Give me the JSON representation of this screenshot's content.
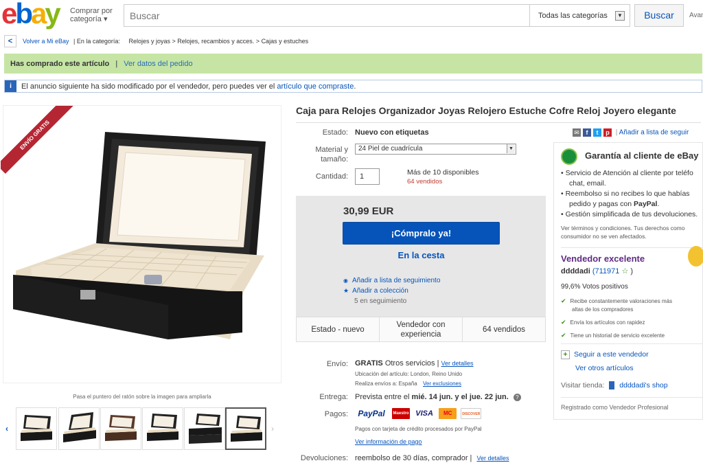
{
  "header": {
    "logo_letters": [
      "e",
      "b",
      "a",
      "y"
    ],
    "logo_colors": [
      "#e53238",
      "#0064d2",
      "#f5af02",
      "#86b817"
    ],
    "shop_by": "Comprar por",
    "shop_by_2": "categoría",
    "search_placeholder": "Buscar",
    "category_select": "Todas las categorías",
    "search_button": "Buscar",
    "advanced": "Avan"
  },
  "breadcrumb": {
    "back": "Volver a Mi eBay",
    "in_category": "| En la categoría:",
    "c1": "Relojes y joyas",
    "c2": "Relojes, recambios y acces.",
    "c3": "Cajas y estuches"
  },
  "purchased_banner": {
    "text": "Has comprado este artículo",
    "sep": "|",
    "link": "Ver datos del pedido"
  },
  "notice_banner": {
    "icon": "i",
    "text": "El anuncio siguiente ha sido modificado por el vendedor, pero puedes ver el",
    "link": "artículo que compraste",
    "end": "."
  },
  "image": {
    "ribbon": "ENVÍO GRATIS",
    "hint": "Pasa el puntero del ratón sobre la imagen para ampliarla",
    "prev_icon": "‹",
    "next_icon": "›"
  },
  "item": {
    "title": "Caja para Relojes Organizador Joyas Relojero Estuche Cofre Reloj Joyero elegante",
    "share_add": "Añadir a lista de seguir",
    "condition_label": "Estado:",
    "condition": "Nuevo con etiquetas",
    "variant_label": "Material y",
    "variant_label_2": "tamaño:",
    "variant_value": "24 Piel de cuadrícula",
    "qty_label": "Cantidad:",
    "qty_value": "1",
    "available": "Más de 10 disponibles",
    "sold": "64 vendidos",
    "price": "30,99 EUR",
    "buy_now": "¡Cómpralo ya!",
    "add_cart": "En la cesta",
    "watch": "Añadir a lista de seguimiento",
    "collection": "Añadir a colección",
    "watchers": "5 en seguimiento",
    "stat1": "Estado - nuevo",
    "stat2a": "Vendedor con",
    "stat2b": "experiencia",
    "stat3": "64 vendidos"
  },
  "shipping": {
    "label": "Envío:",
    "free": "GRATIS",
    "other": "Otros servicios |",
    "details": "Ver detalles",
    "location": "Ubicación del artículo:  London, Reino Unido",
    "ships_to": "Realiza envíos a:  España",
    "exclusions": "Ver exclusiones",
    "delivery_label": "Entrega:",
    "delivery_pre": "Prevista entre el",
    "delivery_dates": "mié. 14 jun. y el jue. 22 jun.",
    "help_icon": "?",
    "payment_label": "Pagos:",
    "paypal": "PayPal",
    "maestro": "Maestro",
    "visa": "VISA",
    "mastercard": "MC",
    "discover": "DISCOVER",
    "paypal_note": "Pagos con tarjeta de crédito procesados por PayPal",
    "pay_info": "Ver información de pago",
    "returns_label": "Devoluciones:",
    "returns": "reembolso de 30 días, comprador |",
    "returns_details": "Ver detalles"
  },
  "guarantee": {
    "title": "Garantía al cliente de eBay",
    "b1a": "Servicio de Atención al cliente por teléfo",
    "b1b": "chat, email.",
    "b2a": "Reembolso si no recibes lo que habías",
    "b2b_pre": "pedido y pagas con",
    "b2b_bold": "PayPal",
    "b2b_end": ".",
    "b3": "Gestión simplificada de tus devoluciones.",
    "terms1": "Ver términos y condiciones. Tus derechos como",
    "terms2": "consumidor no se ven afectados."
  },
  "seller": {
    "title": "Vendedor excelente",
    "name": "ddddadi",
    "score": "(711971",
    "score_end": ")",
    "positive": "99,6% Votos positivos",
    "f1a": "Recibe constantemente valoraciones más",
    "f1b": "altas de los compradores",
    "f2": "Envía los artículos con rapidez",
    "f3": "Tiene un historial de servicio excelente",
    "follow": "Seguir a este vendedor",
    "other_items": "Ver otros artículos",
    "visit": "Visitar tienda:",
    "shop": "ddddadi's shop",
    "registered": "Registrado como Vendedor Profesional"
  }
}
